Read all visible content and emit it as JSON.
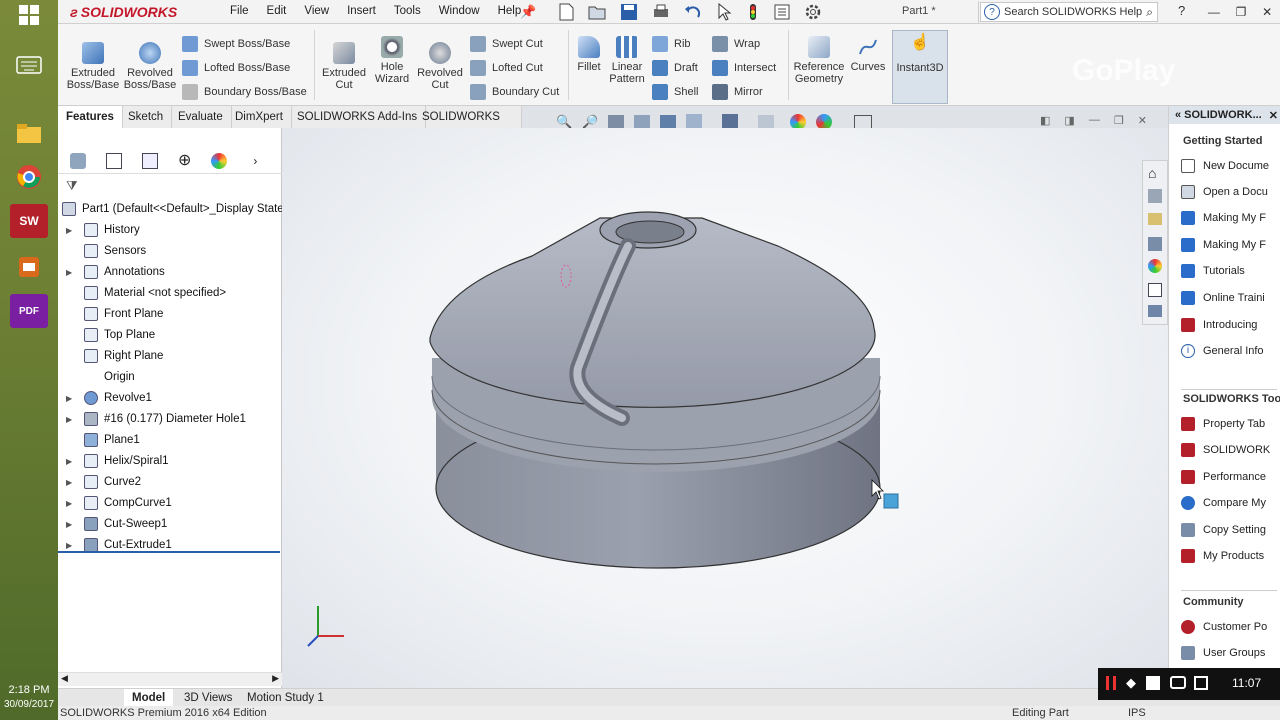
{
  "taskbar": {
    "time": "2:18 PM",
    "date": "30/09/2017"
  },
  "app": {
    "logo": "SOLIDWORKS",
    "doc_title": "Part1 *",
    "search_placeholder": "Search SOLIDWORKS Help"
  },
  "menu": [
    "File",
    "Edit",
    "View",
    "Insert",
    "Tools",
    "Window",
    "Help"
  ],
  "ribbon": {
    "extruded_boss": "Extruded Boss/Base",
    "revolved_boss": "Revolved Boss/Base",
    "swept_boss": "Swept Boss/Base",
    "lofted_boss": "Lofted Boss/Base",
    "boundary_boss": "Boundary Boss/Base",
    "extruded_cut": "Extruded Cut",
    "hole_wizard": "Hole Wizard",
    "revolved_cut": "Revolved Cut",
    "swept_cut": "Swept Cut",
    "lofted_cut": "Lofted Cut",
    "boundary_cut": "Boundary Cut",
    "fillet": "Fillet",
    "linear_pattern": "Linear Pattern",
    "rib": "Rib",
    "draft": "Draft",
    "shell": "Shell",
    "wrap": "Wrap",
    "intersect": "Intersect",
    "mirror": "Mirror",
    "reference_geometry": "Reference Geometry",
    "curves": "Curves",
    "instant3d": "Instant3D"
  },
  "tabs": [
    "Features",
    "Sketch",
    "Evaluate",
    "DimXpert",
    "SOLIDWORKS Add-Ins",
    "SOLIDWORKS MBD"
  ],
  "tree": {
    "root": "Part1  (Default<<Default>_Display State",
    "items": [
      "History",
      "Sensors",
      "Annotations",
      "Material <not specified>",
      "Front Plane",
      "Top Plane",
      "Right Plane",
      "Origin",
      "Revolve1",
      "#16 (0.177) Diameter Hole1",
      "Plane1",
      "Helix/Spiral1",
      "Curve2",
      "CompCurve1",
      "Cut-Sweep1",
      "Cut-Extrude1"
    ]
  },
  "taskpane": {
    "title": "SOLIDWORK...",
    "getting_started": "Getting Started",
    "gs_items": [
      "New Docume",
      "Open a Docu",
      "Making My F",
      "Making My F",
      "Tutorials",
      "Online Traini",
      "Introducing",
      "General Info"
    ],
    "tools_header": "SOLIDWORKS Too",
    "tool_items": [
      "Property Tab",
      "SOLIDWORK",
      "Performance",
      "Compare My",
      "Copy Setting",
      "My Products"
    ],
    "community": "Community",
    "community_items": [
      "Customer Po",
      "User Groups"
    ]
  },
  "bottom_tabs": [
    "Model",
    "3D Views",
    "Motion Study 1"
  ],
  "status": {
    "edition": "SOLIDWORKS Premium 2016 x64 Edition",
    "mode": "Editing Part",
    "units": "IPS"
  },
  "recorder": {
    "time": "11:07"
  },
  "watermark": "GoPlay"
}
